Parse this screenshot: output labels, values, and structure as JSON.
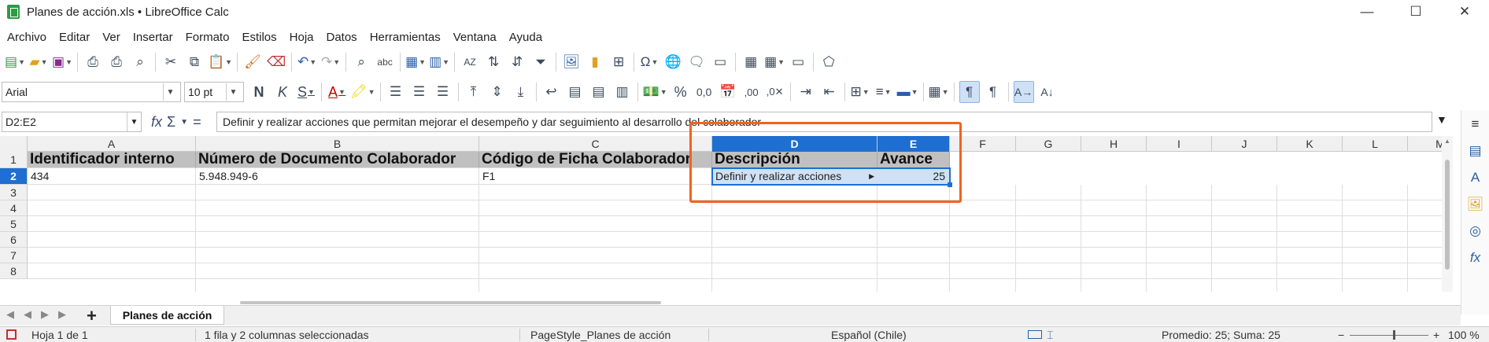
{
  "window": {
    "title": "Planes de acción.xls • LibreOffice Calc",
    "minimize": "—",
    "maximize": "☐",
    "close": "✕"
  },
  "menu": [
    "Archivo",
    "Editar",
    "Ver",
    "Insertar",
    "Formato",
    "Estilos",
    "Hoja",
    "Datos",
    "Herramientas",
    "Ventana",
    "Ayuda"
  ],
  "format_toolbar": {
    "font_name": "Arial",
    "font_size": "10 pt"
  },
  "formula_bar": {
    "name_box": "D2:E2",
    "content": "Definir y realizar acciones que permitan mejorar el desempeño y dar seguimiento al desarrollo del colaborador"
  },
  "columns": [
    "A",
    "B",
    "C",
    "D",
    "E",
    "F",
    "G",
    "H",
    "I",
    "J",
    "K",
    "L",
    "M"
  ],
  "rows": [
    "1",
    "2",
    "3",
    "4",
    "5",
    "6",
    "7",
    "8"
  ],
  "cells": {
    "A1": "Identificador interno",
    "B1": "Número de Documento Colaborador",
    "C1": "Código de Ficha Colaborador",
    "D1": "Descripción",
    "E1": "Avance",
    "A2": "434",
    "B2": "5.948.949-6",
    "C2": "F1",
    "D2": "Definir y realizar acciones",
    "E2": "25"
  },
  "sheet_tabs": {
    "add": "+",
    "active": "Planes de acción"
  },
  "status": {
    "sheet": "Hoja 1 de 1",
    "selection": "1 fila y 2 columnas seleccionadas",
    "page_style": "PageStyle_Planes de acción",
    "language": "Español (Chile)",
    "summary": "Promedio: 25; Suma: 25",
    "zoom": "100 %"
  },
  "colors": {
    "selection": "#1e6fd1",
    "annotation": "#f06420",
    "header_fill": "#c0c0c0"
  }
}
